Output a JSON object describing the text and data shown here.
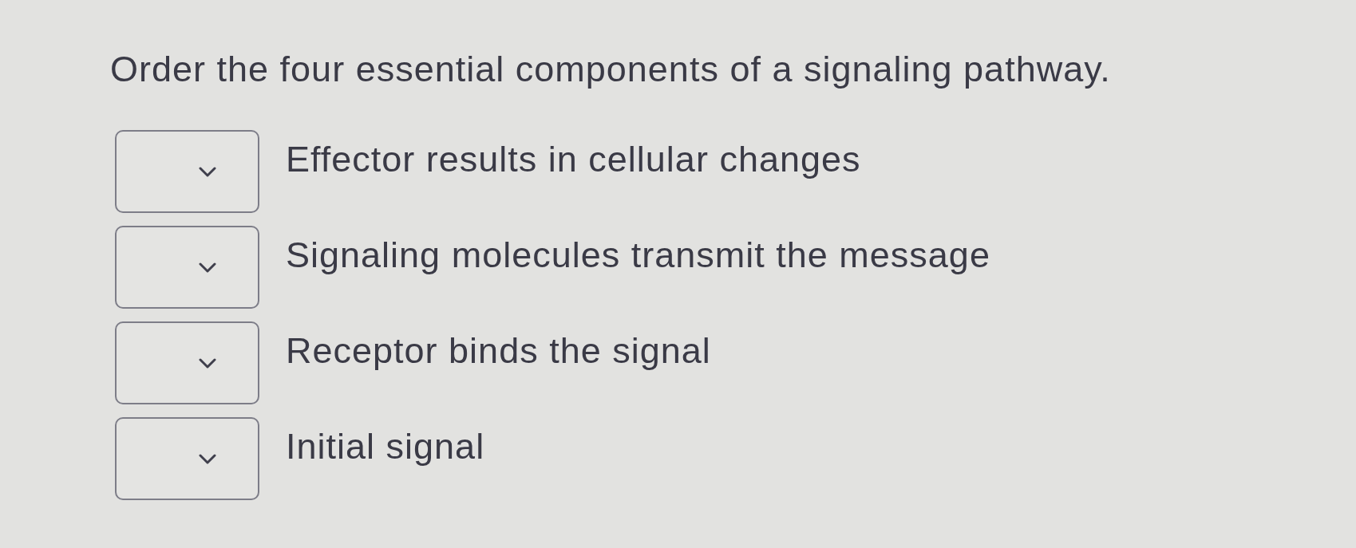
{
  "question": {
    "prompt": "Order the four essential components of a signaling pathway."
  },
  "items": [
    {
      "label": "Effector results in cellular changes"
    },
    {
      "label": "Signaling molecules transmit the message"
    },
    {
      "label": "Receptor binds the signal"
    },
    {
      "label": "Initial signal"
    }
  ]
}
